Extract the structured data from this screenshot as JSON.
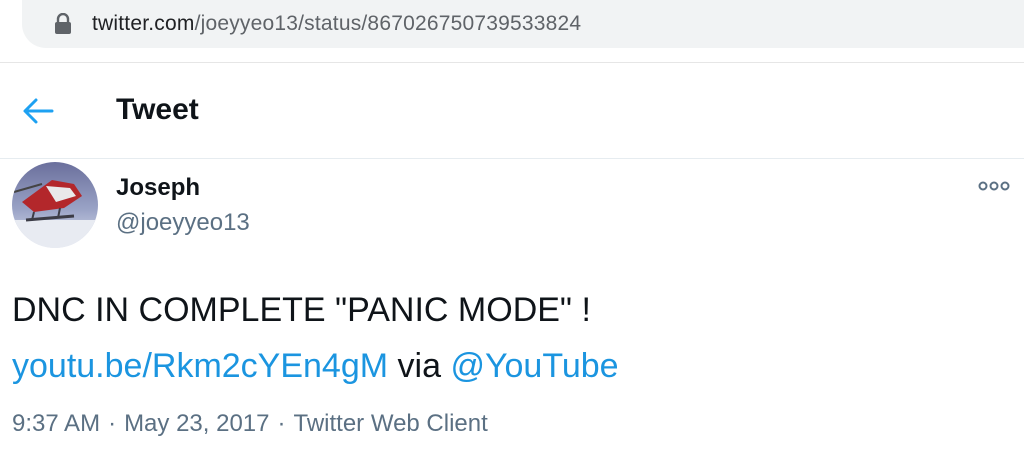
{
  "browser": {
    "url_domain": "twitter.com",
    "url_path": "/joeyyeo13/status/867026750739533824",
    "lock_icon": "lock-icon"
  },
  "header": {
    "back_icon": "arrow-left-icon",
    "title": "Tweet"
  },
  "tweet": {
    "author_name": "Joseph",
    "author_handle": "@joeyyeo13",
    "more_icon": "more-horizontal-icon",
    "text_line1": "DNC IN COMPLETE \"PANIC MODE\" !",
    "link_text": "youtu.be/Rkm2cYEn4gM",
    "via_text": "via",
    "mention": "@YouTube",
    "time": "9:37 AM",
    "date": "May 23, 2017",
    "client": "Twitter Web Client",
    "separator": "·"
  },
  "colors": {
    "link": "#1b95e0",
    "secondary_text": "#5b7083",
    "primary_text": "#0f1419"
  }
}
